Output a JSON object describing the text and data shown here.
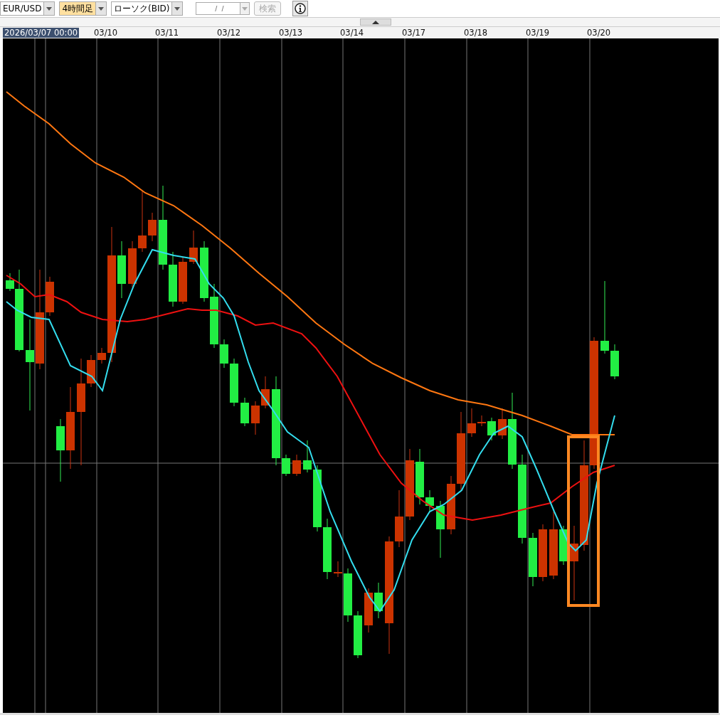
{
  "toolbar": {
    "symbol": "EUR/USD",
    "period": {
      "label": "4時間足",
      "highlighted": true
    },
    "chart_type": "ローソク(BID)",
    "date_field": {
      "placeholder": " /  /"
    },
    "search_button": {
      "label": "検索",
      "disabled": true
    }
  },
  "date_axis": [
    {
      "label": "2026/03/07 00:00",
      "highlighted": true
    },
    {
      "label": "03/10",
      "highlighted": false
    },
    {
      "label": "03/11",
      "highlighted": false
    },
    {
      "label": "03/12",
      "highlighted": false
    },
    {
      "label": "03/13",
      "highlighted": false
    },
    {
      "label": "03/14",
      "highlighted": false
    },
    {
      "label": "03/17",
      "highlighted": false
    },
    {
      "label": "03/18",
      "highlighted": false
    },
    {
      "label": "03/19",
      "highlighted": false
    },
    {
      "label": "03/20",
      "highlighted": false
    }
  ]
}
